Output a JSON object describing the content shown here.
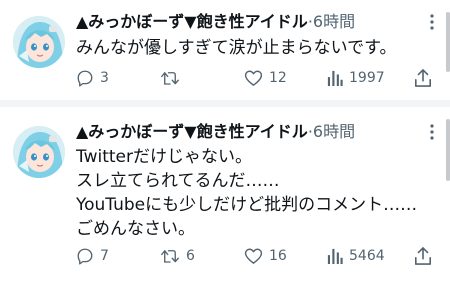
{
  "tweets": [
    {
      "display_name": "▲みっかぼーず▼飽き性アイドル",
      "separator": "·",
      "time": "6時間",
      "lines": [
        "みんなが優しすぎて涙が止まらないです。"
      ],
      "replies": "3",
      "retweets": "",
      "likes": "12",
      "views": "1997"
    },
    {
      "display_name": "▲みっかぼーず▼飽き性アイドル",
      "separator": "·",
      "time": "6時間",
      "lines": [
        "Twitterだけじゃない。",
        "スレ立てられてるんだ……",
        "YouTubeにも少しだけど批判のコメント……",
        "ごめんなさい。"
      ],
      "replies": "7",
      "retweets": "6",
      "likes": "16",
      "views": "5464"
    }
  ],
  "icons": {
    "more": "more-dots-icon",
    "reply": "reply-icon",
    "retweet": "retweet-icon",
    "like": "heart-icon",
    "views": "views-icon",
    "share": "share-icon"
  },
  "colors": {
    "text": "#0f1419",
    "meta": "#536471",
    "separator_bg": "#f3f4f6",
    "avatar_hair": "#7fd0e6"
  }
}
